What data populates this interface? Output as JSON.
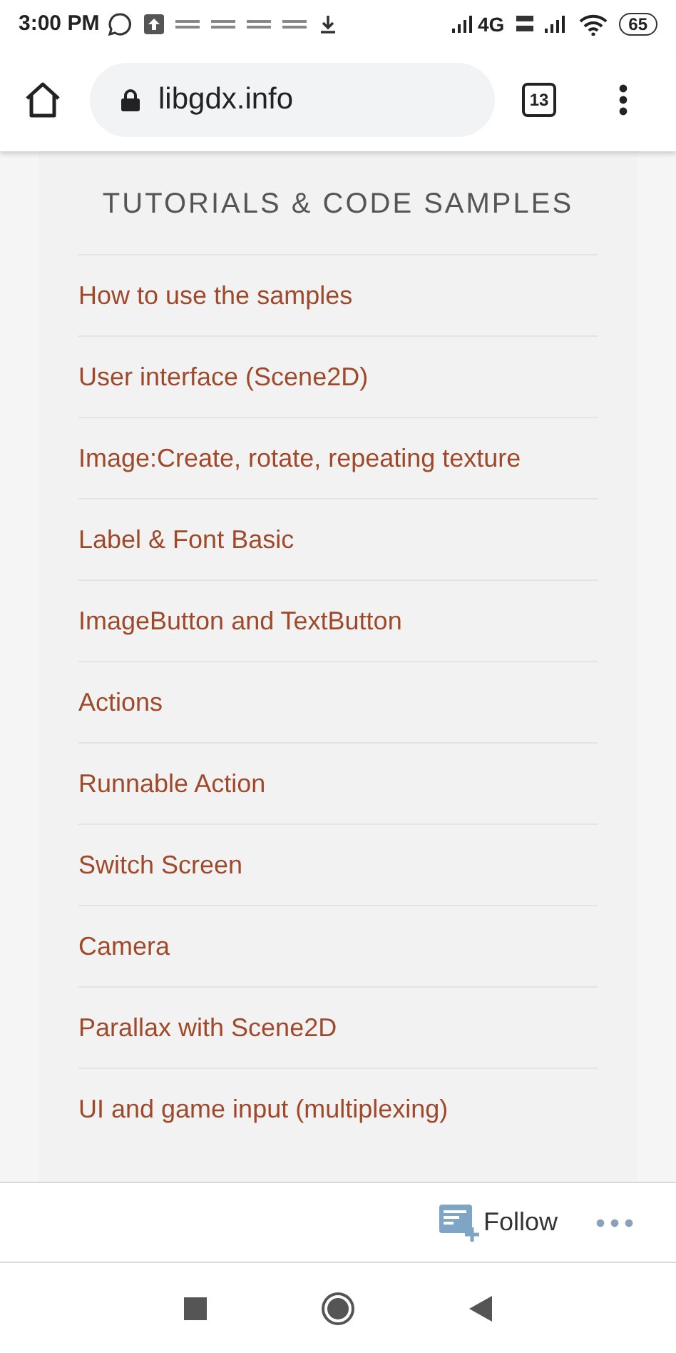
{
  "status_bar": {
    "time": "3:00 PM",
    "network": "4G",
    "battery": "65"
  },
  "browser": {
    "url": "libgdx.info",
    "tab_count": "13"
  },
  "section": {
    "title": "TUTORIALS & CODE SAMPLES",
    "links": [
      "How to use the samples",
      "User interface (Scene2D)",
      "Image:Create, rotate, repeating texture",
      "Label & Font Basic",
      "ImageButton and TextButton",
      "Actions",
      "Runnable Action",
      "Switch Screen",
      "Camera",
      "Parallax with Scene2D",
      "UI and game input (multiplexing)"
    ]
  },
  "follow_bar": {
    "label": "Follow"
  }
}
